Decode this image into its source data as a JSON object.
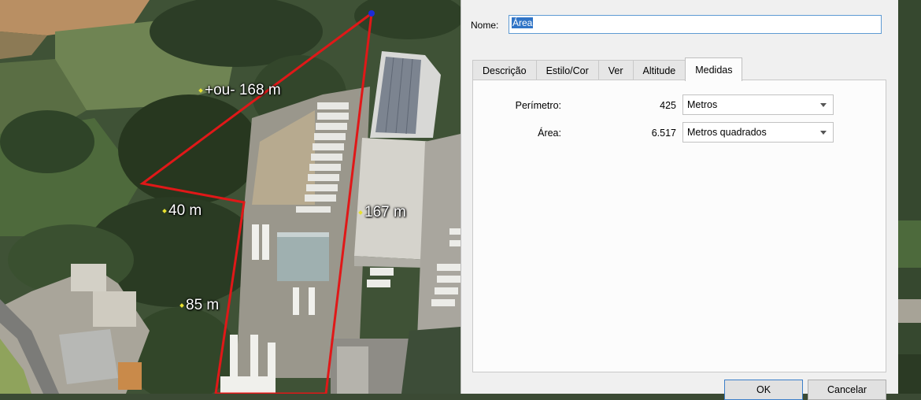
{
  "map": {
    "measurements": [
      {
        "id": "top-edge",
        "text": "+ou- 168 m"
      },
      {
        "id": "left-edge",
        "text": "40 m"
      },
      {
        "id": "right-edge",
        "text": "167 m"
      },
      {
        "id": "bottom-edge",
        "text": "85 m"
      }
    ],
    "colors": {
      "polygon": "#e01818",
      "vertex": "#1c2cd8"
    }
  },
  "dialog": {
    "name_label": "Nome:",
    "name_value": "Área",
    "tabs": [
      {
        "label": "Descrição",
        "active": false
      },
      {
        "label": "Estilo/Cor",
        "active": false
      },
      {
        "label": "Ver",
        "active": false
      },
      {
        "label": "Altitude",
        "active": false
      },
      {
        "label": "Medidas",
        "active": true
      }
    ],
    "measures": {
      "perimeter": {
        "label": "Perímetro:",
        "value": "425",
        "unit": "Metros"
      },
      "area": {
        "label": "Área:",
        "value": "6.517",
        "unit": "Metros quadrados"
      }
    },
    "buttons": {
      "ok": "OK",
      "cancel": "Cancelar"
    }
  }
}
